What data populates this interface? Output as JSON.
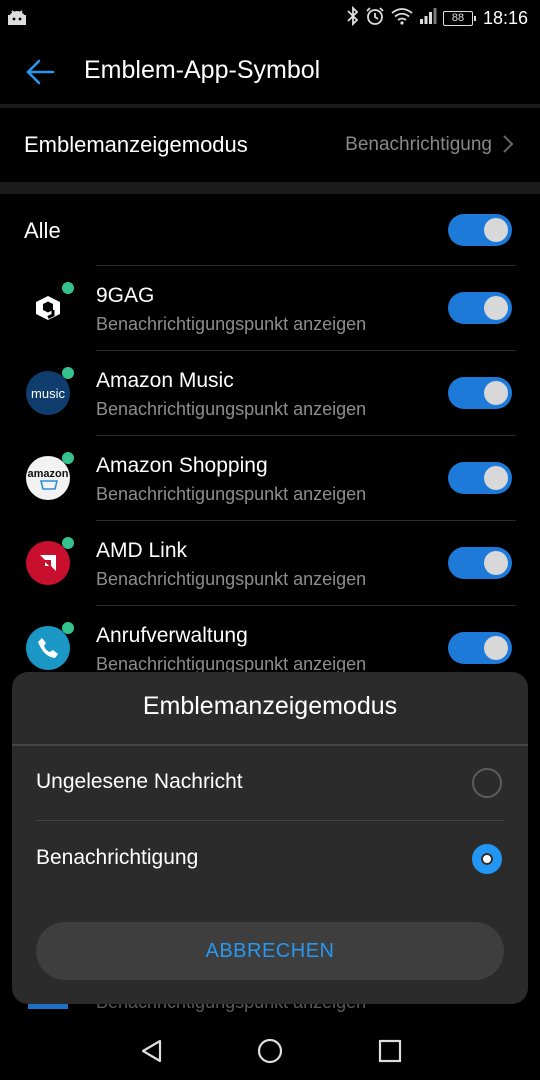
{
  "status_bar": {
    "time": "18:16",
    "battery": "88",
    "icons": [
      "android-debug-icon",
      "bluetooth-icon",
      "alarm-icon",
      "wifi-icon",
      "signal-icon",
      "battery-icon"
    ]
  },
  "app_bar": {
    "back_icon": "back-arrow-icon",
    "title": "Emblem-App-Symbol"
  },
  "badge_mode": {
    "label": "Emblemanzeigemodus",
    "value": "Benachrichtigung"
  },
  "all_toggle": {
    "label": "Alle",
    "enabled": true
  },
  "apps": [
    {
      "name": "9GAG",
      "subtitle": "Benachrichtigungspunkt anzeigen",
      "enabled": true,
      "icon": "9gag-icon"
    },
    {
      "name": "Amazon Music",
      "subtitle": "Benachrichtigungspunkt anzeigen",
      "enabled": true,
      "icon": "amazon-music-icon",
      "icon_text": "music"
    },
    {
      "name": "Amazon Shopping",
      "subtitle": "Benachrichtigungspunkt anzeigen",
      "enabled": true,
      "icon": "amazon-shopping-icon",
      "icon_text": "amazon"
    },
    {
      "name": "AMD Link",
      "subtitle": "Benachrichtigungspunkt anzeigen",
      "enabled": true,
      "icon": "amd-link-icon"
    },
    {
      "name": "Anrufverwaltung",
      "subtitle": "Benachrichtigungspunkt anzeigen",
      "enabled": true,
      "icon": "phone-icon"
    }
  ],
  "partially_visible_item": {
    "subtitle": "Benachrichtigungspunkt anzeigen"
  },
  "dialog": {
    "title": "Emblemanzeigemodus",
    "options": [
      {
        "label": "Ungelesene Nachricht",
        "selected": false
      },
      {
        "label": "Benachrichtigung",
        "selected": true
      }
    ],
    "cancel_label": "ABBRECHEN"
  },
  "nav_bar": {
    "buttons": [
      "back-triangle-icon",
      "home-circle-icon",
      "recents-square-icon"
    ]
  },
  "colors": {
    "accent": "#2196f3",
    "switch_on": "#1d7ad8",
    "notification_dot": "#35c28f",
    "background": "#000000",
    "dialog_bg": "#2b2b2b"
  }
}
